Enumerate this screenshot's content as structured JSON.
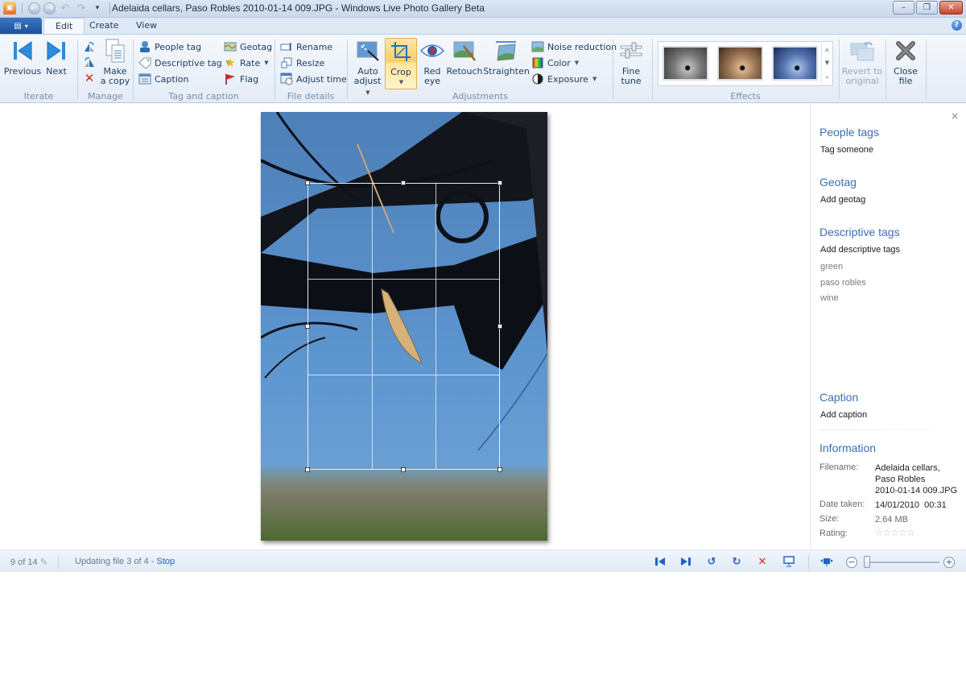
{
  "window": {
    "title": "Adelaida cellars, Paso Robles 2010-01-14 009.JPG - Windows Live Photo Gallery Beta",
    "controls": {
      "minimize": "–",
      "restore": "❐",
      "close": "✕"
    }
  },
  "quick_access": {
    "app_icon": "photo-gallery-icon",
    "back": "←",
    "forward": "→",
    "undo": "↶",
    "redo": "↷",
    "customize": "▾"
  },
  "tabs": [
    {
      "label": "Edit",
      "active": true
    },
    {
      "label": "Create",
      "active": false
    },
    {
      "label": "View",
      "active": false
    }
  ],
  "app_menu": {
    "glyph": "▤",
    "caret": "▾"
  },
  "help": "?",
  "ribbon": {
    "iterate": {
      "label": "Iterate",
      "previous": "Previous",
      "next": "Next"
    },
    "manage": {
      "label": "Manage",
      "make_copy_line1": "Make",
      "make_copy_line2": "a copy"
    },
    "tag_caption": {
      "label": "Tag and caption",
      "people_tag": "People tag",
      "descriptive_tag": "Descriptive tag",
      "caption": "Caption",
      "geotag": "Geotag",
      "rate": "Rate",
      "flag": "Flag"
    },
    "file_details": {
      "label": "File details",
      "rename": "Rename",
      "resize": "Resize",
      "adjust_time": "Adjust time"
    },
    "adjustments": {
      "label": "Adjustments",
      "auto_adjust_line1": "Auto",
      "auto_adjust_line2": "adjust",
      "crop": "Crop",
      "red_eye_line1": "Red",
      "red_eye_line2": "eye",
      "retouch": "Retouch",
      "straighten": "Straighten",
      "noise_reduction": "Noise reduction",
      "color": "Color",
      "exposure": "Exposure",
      "fine_tune_line1": "Fine",
      "fine_tune_line2": "tune"
    },
    "effects": {
      "label": "Effects",
      "thumbnails": [
        "Black and white",
        "Sepia",
        "Cyan tone"
      ]
    },
    "revert_line1": "Revert to",
    "revert_line2": "original",
    "close_file_line1": "Close",
    "close_file_line2": "file"
  },
  "side_pane": {
    "close": "×",
    "people_tags": {
      "heading": "People tags",
      "action": "Tag someone"
    },
    "geotag": {
      "heading": "Geotag",
      "action": "Add geotag"
    },
    "descriptive_tags": {
      "heading": "Descriptive tags",
      "action": "Add descriptive tags",
      "tags": [
        "green",
        "paso robles",
        "wine"
      ]
    },
    "caption": {
      "heading": "Caption",
      "action": "Add caption"
    },
    "information": {
      "heading": "Information",
      "filename_label": "Filename:",
      "filename_lines": [
        "Adelaida cellars,",
        "Paso Robles",
        "2010-01-14 009.JPG"
      ],
      "date_label": "Date taken:",
      "date_value": "14/01/2010  00:31",
      "size_label": "Size:",
      "size_value": "2.64 MB",
      "rating_label": "Rating:",
      "rating_value": 0,
      "rating_max": 5,
      "rating_glyphs": "☆☆☆☆☆"
    }
  },
  "status_bar": {
    "position": "9 of 14",
    "edit_glyph": "✎",
    "progress_text": "Updating file 3 of 4 - ",
    "stop_link": "Stop",
    "buttons": {
      "first": "⏮",
      "last": "⏭",
      "rotate_left": "↺",
      "rotate_right": "↻",
      "delete": "✕",
      "slideshow": "▣",
      "fit": "⤧",
      "zoom_out": "−",
      "zoom_in": "+"
    },
    "zoom_level": 0.05
  },
  "colors": {
    "accent": "#3b6eb1",
    "crop_highlight": "#f9cc6a",
    "link": "#1d63c5",
    "delete_red": "#d7261e"
  }
}
